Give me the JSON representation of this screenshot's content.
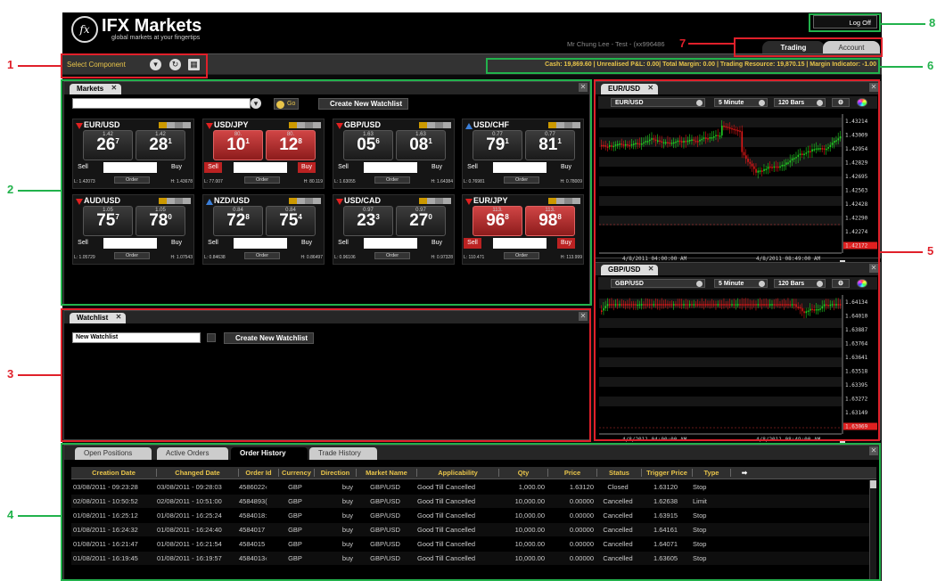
{
  "header": {
    "logo_icon": "fx-circle-logo",
    "brand": "IFX Markets",
    "tagline": "global markets at your fingertips",
    "user": "Mr Chung Lee - Test - (xx996486",
    "logoff": "Log Off",
    "tabs": [
      "Trading",
      "Account"
    ]
  },
  "toolbar": {
    "select_component": "Select Component",
    "cash_bar": "Cash: 19,869.60 | Unrealised P&L: 0.00| Total Margin: 0.00 | Trading Resource: 19,870.15  | Margin Indicator: -1.00"
  },
  "markets": {
    "tab": "Markets",
    "go": "Go",
    "create": "Create New Watchlist",
    "sell": "Sell",
    "buy": "Buy",
    "order": "Order",
    "tiles": [
      {
        "pair": "EUR/USD",
        "dir": "down",
        "bid_small": "1.42",
        "bid_big": "26",
        "bid_sup": "7",
        "ask_small": "1.42",
        "ask_big": "28",
        "ask_sup": "1",
        "low": "L: 1.42073",
        "high": "H: 1.43678",
        "red": false
      },
      {
        "pair": "USD/JPY",
        "dir": "down",
        "bid_small": "80.",
        "bid_big": "10",
        "bid_sup": "1",
        "ask_small": "80.",
        "ask_big": "12",
        "ask_sup": "8",
        "low": "L: 77.007",
        "high": "H: 80.119",
        "red": true
      },
      {
        "pair": "GBP/USD",
        "dir": "down",
        "bid_small": "1.63",
        "bid_big": "05",
        "bid_sup": "6",
        "ask_small": "1.63",
        "ask_big": "08",
        "ask_sup": "1",
        "low": "L: 1.63055",
        "high": "H: 1.64384",
        "red": false
      },
      {
        "pair": "USD/CHF",
        "dir": "up",
        "bid_small": "0.77",
        "bid_big": "79",
        "bid_sup": "1",
        "ask_small": "0.77",
        "ask_big": "81",
        "ask_sup": "1",
        "low": "L: 0.76981",
        "high": "H: 0.78009",
        "red": false
      },
      {
        "pair": "AUD/USD",
        "dir": "down",
        "bid_small": "1.05",
        "bid_big": "75",
        "bid_sup": "7",
        "ask_small": "1.05",
        "ask_big": "78",
        "ask_sup": "0",
        "low": "L: 1.05729",
        "high": "H: 1.07543",
        "red": false
      },
      {
        "pair": "NZD/USD",
        "dir": "up",
        "bid_small": "0.84",
        "bid_big": "72",
        "bid_sup": "8",
        "ask_small": "0.84",
        "ask_big": "75",
        "ask_sup": "4",
        "low": "L: 0.84638",
        "high": "H: 0.86497",
        "red": false
      },
      {
        "pair": "USD/CAD",
        "dir": "down",
        "bid_small": "0.97",
        "bid_big": "23",
        "bid_sup": "3",
        "ask_small": "0.97",
        "ask_big": "27",
        "ask_sup": "0",
        "low": "L: 0.96106",
        "high": "H: 0.97328",
        "red": false
      },
      {
        "pair": "EUR/JPY",
        "dir": "down",
        "bid_small": "113.",
        "bid_big": "96",
        "bid_sup": "8",
        "ask_small": "113.",
        "ask_big": "98",
        "ask_sup": "8",
        "low": "L: 110.471",
        "high": "H: 113.999",
        "red": true
      }
    ]
  },
  "watchlist": {
    "tab": "Watchlist",
    "name_value": "New Watchlist",
    "create": "Create New Watchlist"
  },
  "charts": [
    {
      "tab": "EUR/USD",
      "symbol": "EUR/USD",
      "interval": "5 Minute",
      "bars": "120 Bars",
      "prices": [
        "1.43214",
        "1.43009",
        "1.42954",
        "1.42829",
        "1.42695",
        "1.42563",
        "1.42428",
        "1.42290",
        "1.42274",
        "1.42172"
      ],
      "date_left": "4/8/2011 04:00:00 AM",
      "date_right": "4/8/2011 08:49:00 AM"
    },
    {
      "tab": "GBP/USD",
      "symbol": "GBP/USD",
      "interval": "5 Minute",
      "bars": "120 Bars",
      "prices": [
        "1.64134",
        "1.64010",
        "1.63887",
        "1.63764",
        "1.63641",
        "1.63518",
        "1.63395",
        "1.63272",
        "1.63149",
        "1.63069"
      ],
      "date_left": "4/8/2011 04:00:00 AM",
      "date_right": "4/8/2011 08:49:00 AM"
    }
  ],
  "history": {
    "tabs": [
      "Open Positions",
      "Active Orders",
      "Order History",
      "Trade History"
    ],
    "columns": [
      "Creation Date",
      "Changed Date",
      "Order Id",
      "Currency",
      "Direction",
      "Market Name",
      "Applicability",
      "Qty",
      "Price",
      "Status",
      "Trigger Price",
      "Type"
    ],
    "rows": [
      [
        "03/08/2011 - 09:23:28",
        "03/08/2011 - 09:28:03",
        "4586022‹",
        "GBP",
        "buy",
        "GBP/USD",
        "Good Till Cancelled",
        "1,000.00",
        "1.63120",
        "Closed",
        "1.63120",
        "Stop"
      ],
      [
        "02/08/2011 - 10:50:52",
        "02/08/2011 - 10:51:00",
        "4584893(",
        "GBP",
        "buy",
        "GBP/USD",
        "Good Till Cancelled",
        "10,000.00",
        "0.00000",
        "Cancelled",
        "1.62638",
        "Limit"
      ],
      [
        "01/08/2011 - 16:25:12",
        "01/08/2011 - 16:25:24",
        "4584018:",
        "GBP",
        "buy",
        "GBP/USD",
        "Good Till Cancelled",
        "10,000.00",
        "0.00000",
        "Cancelled",
        "1.63915",
        "Stop"
      ],
      [
        "01/08/2011 - 16:24:32",
        "01/08/2011 - 16:24:40",
        "4584017",
        "GBP",
        "buy",
        "GBP/USD",
        "Good Till Cancelled",
        "10,000.00",
        "0.00000",
        "Cancelled",
        "1.64161",
        "Stop"
      ],
      [
        "01/08/2011 - 16:21:47",
        "01/08/2011 - 16:21:54",
        "4584015",
        "GBP",
        "buy",
        "GBP/USD",
        "Good Till Cancelled",
        "10,000.00",
        "0.00000",
        "Cancelled",
        "1.64071",
        "Stop"
      ],
      [
        "01/08/2011 - 16:19:45",
        "01/08/2011 - 16:19:57",
        "4584013‹",
        "GBP",
        "buy",
        "GBP/USD",
        "Good Till Cancelled",
        "10,000.00",
        "0.00000",
        "Cancelled",
        "1.63605",
        "Stop"
      ]
    ]
  },
  "callouts": [
    "1",
    "2",
    "3",
    "4",
    "5",
    "6",
    "7",
    "8"
  ],
  "colors": {
    "accent": "#e8c44a",
    "green_frame": "#22b24c",
    "red_frame": "#e0202a",
    "bull": "#22d022",
    "bear": "#e01818"
  }
}
